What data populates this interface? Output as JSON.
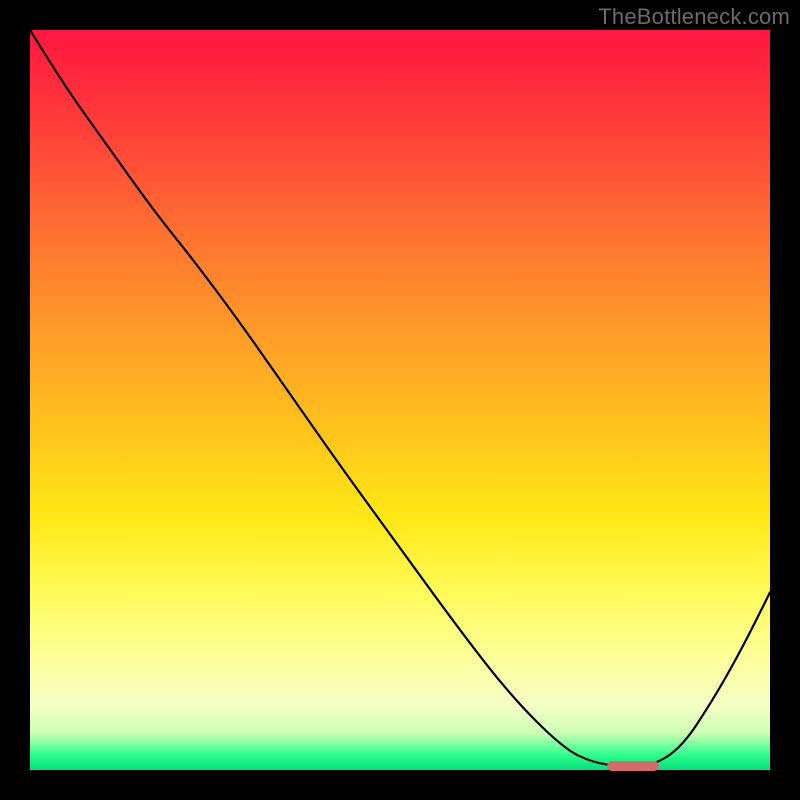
{
  "attribution": "TheBottleneck.com",
  "colors": {
    "gradient_top": "#ff163f",
    "gradient_mid_orange": "#ff9f28",
    "gradient_yellow": "#ffe815",
    "gradient_pale": "#f6ffc4",
    "gradient_green": "#00e07a",
    "curve": "#000000",
    "marker": "#d46a6a",
    "background": "#000000"
  },
  "chart_data": {
    "type": "line",
    "title": "",
    "xlabel": "",
    "ylabel": "",
    "x_range": [
      0,
      100
    ],
    "y_range": [
      0,
      100
    ],
    "x": [
      0,
      5,
      10,
      15,
      18,
      22,
      28,
      35,
      42,
      50,
      58,
      65,
      72,
      76,
      80,
      84,
      88,
      92,
      96,
      100
    ],
    "y": [
      100,
      92,
      85,
      78,
      74,
      69,
      61,
      51,
      41,
      30,
      19,
      10,
      3,
      1,
      0.5,
      0.5,
      3,
      9,
      16,
      24
    ],
    "marker": {
      "x_start": 78,
      "x_end": 85,
      "y": 0.5
    },
    "annotations": []
  }
}
